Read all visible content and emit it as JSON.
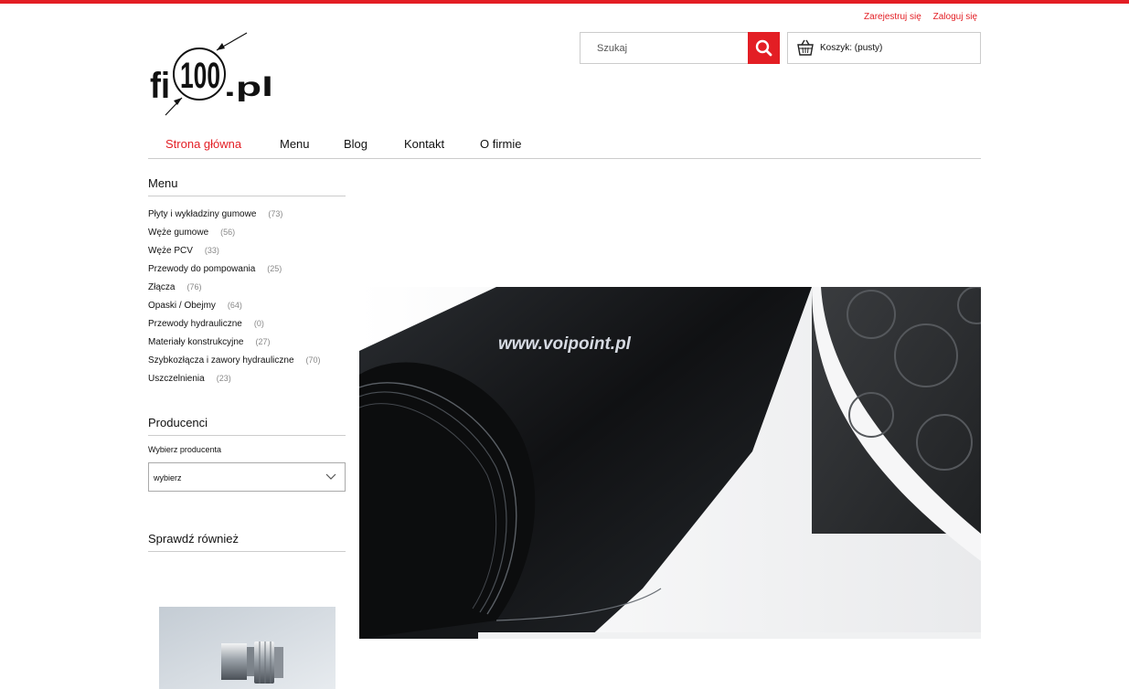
{
  "header": {
    "register_link": "Zarejestruj się",
    "login_link": "Zaloguj się",
    "logo_alt": "fi100.pl"
  },
  "search": {
    "placeholder": "Szukaj"
  },
  "cart": {
    "label": "Koszyk:",
    "status": "(pusty)"
  },
  "nav": {
    "items": [
      {
        "label": "Strona główna",
        "active": true
      },
      {
        "label": "Menu"
      },
      {
        "label": "Blog"
      },
      {
        "label": "Kontakt"
      },
      {
        "label": "O firmie"
      }
    ]
  },
  "sidebar": {
    "menu_title": "Menu",
    "categories": [
      {
        "label": "Płyty i wykładziny gumowe",
        "count": "(73)"
      },
      {
        "label": "Węże gumowe",
        "count": "(56)"
      },
      {
        "label": "Węże PCV",
        "count": "(33)"
      },
      {
        "label": "Przewody do pompowania",
        "count": "(25)"
      },
      {
        "label": "Złącza",
        "count": "(76)"
      },
      {
        "label": "Opaski / Obejmy",
        "count": "(64)"
      },
      {
        "label": "Przewody hydrauliczne",
        "count": "(0)"
      },
      {
        "label": "Materiały konstrukcyjne",
        "count": "(27)"
      },
      {
        "label": "Szybkozłącza i zawory hydrauliczne",
        "count": "(70)"
      },
      {
        "label": "Uszczelnienia",
        "count": "(23)"
      }
    ],
    "producers_title": "Producenci",
    "producer_label": "Wybierz producenta",
    "producer_selected": "wybierz",
    "check_also_title": "Sprawdź również"
  },
  "banner": {
    "watermark": "www.voipoint.pl"
  },
  "colors": {
    "accent": "#e31e24"
  }
}
